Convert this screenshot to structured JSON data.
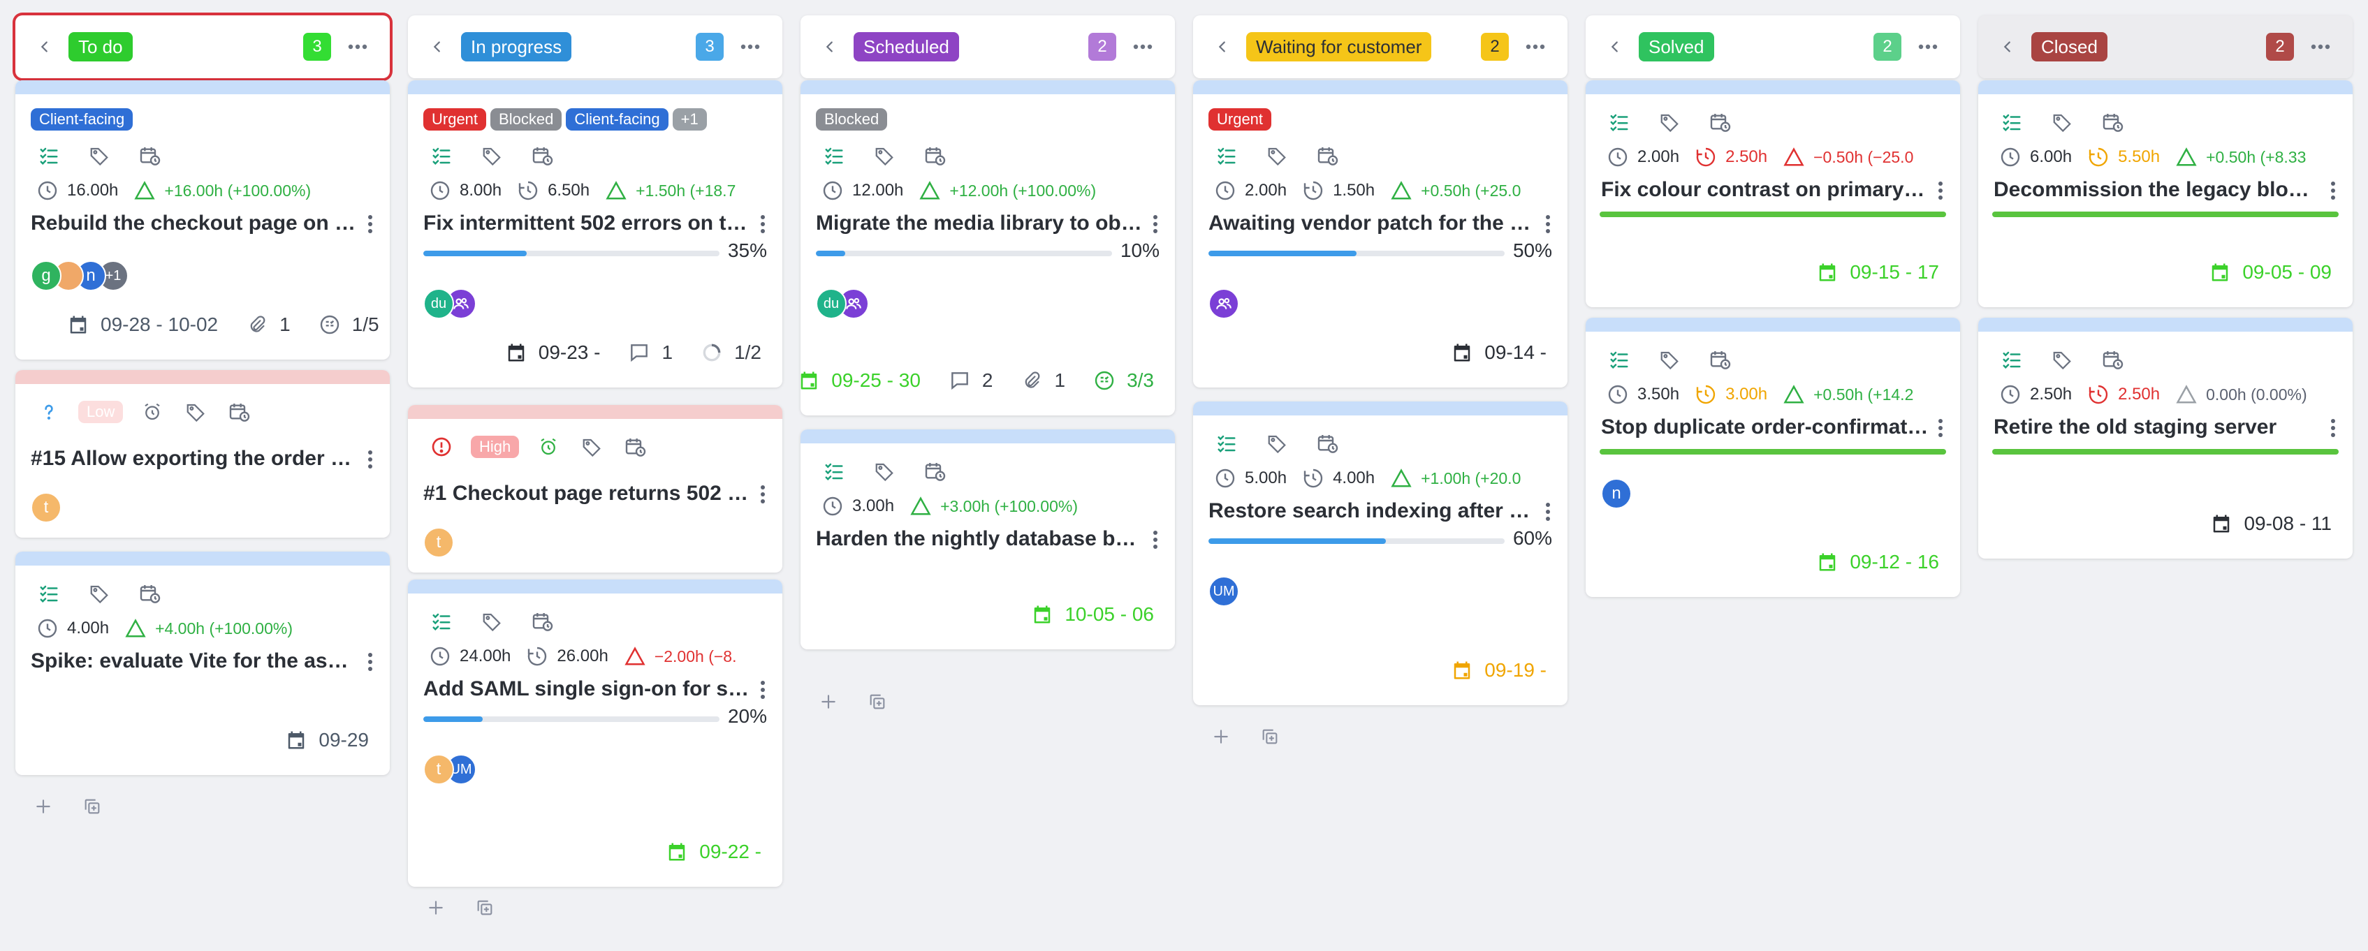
{
  "colors": {
    "urgent": "#e03131",
    "blocked": "#8a8d93",
    "client_facing": "#2f6fd6",
    "extra": "#9aa0a6",
    "low_bg": "#fcdede",
    "high_bg": "#f8a7a9",
    "green": "#2fb043",
    "red": "#e03131",
    "orange": "#f0a500",
    "blue_bar": "#3d9be9",
    "bright_green": "#3bd12a"
  },
  "columns": [
    {
      "id": "todo",
      "title": "To do",
      "count": "3",
      "chip_color": "#2ecc2e",
      "badge_bg": "#33dd33",
      "badge_fg": "#ffffff",
      "selected": true,
      "cards": [
        {
          "tags": [
            "Client-facing"
          ],
          "estimate": "16.00h",
          "delta": "+16.00h (+100.00%)",
          "title": "Rebuild the checkout page on th…",
          "avatars": [
            "g",
            "",
            "n",
            "+1"
          ],
          "date": "09-28 - 10-02",
          "attachments": "1",
          "subtasks": "1/5"
        },
        {
          "priority_icon": "?",
          "priority": "Low",
          "title": "#15 Allow exporting the order hi…",
          "avatars": [
            "t"
          ]
        },
        {
          "estimate": "4.00h",
          "delta": "+4.00h (+100.00%)",
          "title": "Spike: evaluate Vite for the asset…",
          "date": "09-29"
        }
      ]
    },
    {
      "id": "inprogress",
      "title": "In progress",
      "count": "3",
      "chip_color": "#2f8fd8",
      "badge_bg": "#4aa8e8",
      "badge_fg": "#ffffff",
      "cards": [
        {
          "tags": [
            "Urgent",
            "Blocked",
            "Client-facing",
            "+1"
          ],
          "estimate": "8.00h",
          "spent": "6.50h",
          "delta": "+1.50h (+18.7",
          "title": "Fix intermittent 502 errors on th…",
          "progress": 35,
          "progress_label": "35%",
          "avatars": [
            "du",
            ""
          ],
          "date": "09-23 -",
          "comments": "1",
          "subtasks": "1/2"
        },
        {
          "priority_icon": "!",
          "priority": "High",
          "title": "#1 Checkout page returns 502 d…",
          "avatars": [
            "t"
          ]
        },
        {
          "estimate": "24.00h",
          "spent": "26.00h",
          "delta": "−2.00h (−8.",
          "title": "Add SAML single sign-on for staf…",
          "progress": 20,
          "progress_label": "20%",
          "avatars": [
            "t",
            "UM"
          ],
          "date": "09-22 -"
        }
      ]
    },
    {
      "id": "scheduled",
      "title": "Scheduled",
      "count": "2",
      "chip_color": "#8e44c4",
      "badge_bg": "#b27ad8",
      "badge_fg": "#ffffff",
      "cards": [
        {
          "tags": [
            "Blocked"
          ],
          "estimate": "12.00h",
          "delta": "+12.00h (+100.00%)",
          "title": "Migrate the media library to obj…",
          "progress": 10,
          "progress_label": "10%",
          "avatars": [
            "du",
            ""
          ],
          "date": "09-25 - 30",
          "comments": "2",
          "attachments": "1",
          "subtasks": "3/3"
        },
        {
          "estimate": "3.00h",
          "delta": "+3.00h (+100.00%)",
          "title": "Harden the nightly database bac…",
          "date": "10-05 - 06"
        }
      ]
    },
    {
      "id": "waiting",
      "title": "Waiting for customer",
      "count": "2",
      "chip_color": "#f5c518",
      "badge_bg": "#f5c518",
      "badge_fg": "#2b2f36",
      "cards": [
        {
          "tags": [
            "Urgent"
          ],
          "estimate": "2.00h",
          "spent": "1.50h",
          "delta": "+0.50h (+25.0",
          "title": "Awaiting vendor patch for the p…",
          "progress": 50,
          "progress_label": "50%",
          "avatars": [
            ""
          ],
          "date": "09-14 -"
        },
        {
          "estimate": "5.00h",
          "spent": "4.00h",
          "delta": "+1.00h (+20.0",
          "title": "Restore search indexing after th…",
          "progress": 60,
          "progress_label": "60%",
          "avatars": [
            "UM"
          ],
          "date": "09-19 -"
        }
      ]
    },
    {
      "id": "solved",
      "title": "Solved",
      "count": "2",
      "chip_color": "#2fc35f",
      "badge_bg": "#5cd08a",
      "badge_fg": "#ffffff",
      "cards": [
        {
          "estimate": "2.00h",
          "spent": "2.50h",
          "delta": "−0.50h (−25.0",
          "title": "Fix colour contrast on primary b…",
          "date": "09-15 - 17"
        },
        {
          "estimate": "3.50h",
          "spent": "3.00h",
          "delta": "+0.50h (+14.2",
          "title": "Stop duplicate order-confirmati…",
          "avatars": [
            "n"
          ],
          "date": "09-12 - 16"
        }
      ]
    },
    {
      "id": "closed",
      "title": "Closed",
      "count": "2",
      "chip_color": "#a94442",
      "badge_bg": "#b04a48",
      "badge_fg": "#ffffff",
      "cards": [
        {
          "estimate": "6.00h",
          "spent": "5.50h",
          "delta": "+0.50h (+8.33",
          "title": "Decommission the legacy blog a…",
          "date": "09-05 - 09"
        },
        {
          "estimate": "2.50h",
          "spent": "2.50h",
          "delta": "0.00h (0.00%)",
          "title": "Retire the old staging server",
          "date": "09-08 - 11"
        }
      ]
    }
  ]
}
